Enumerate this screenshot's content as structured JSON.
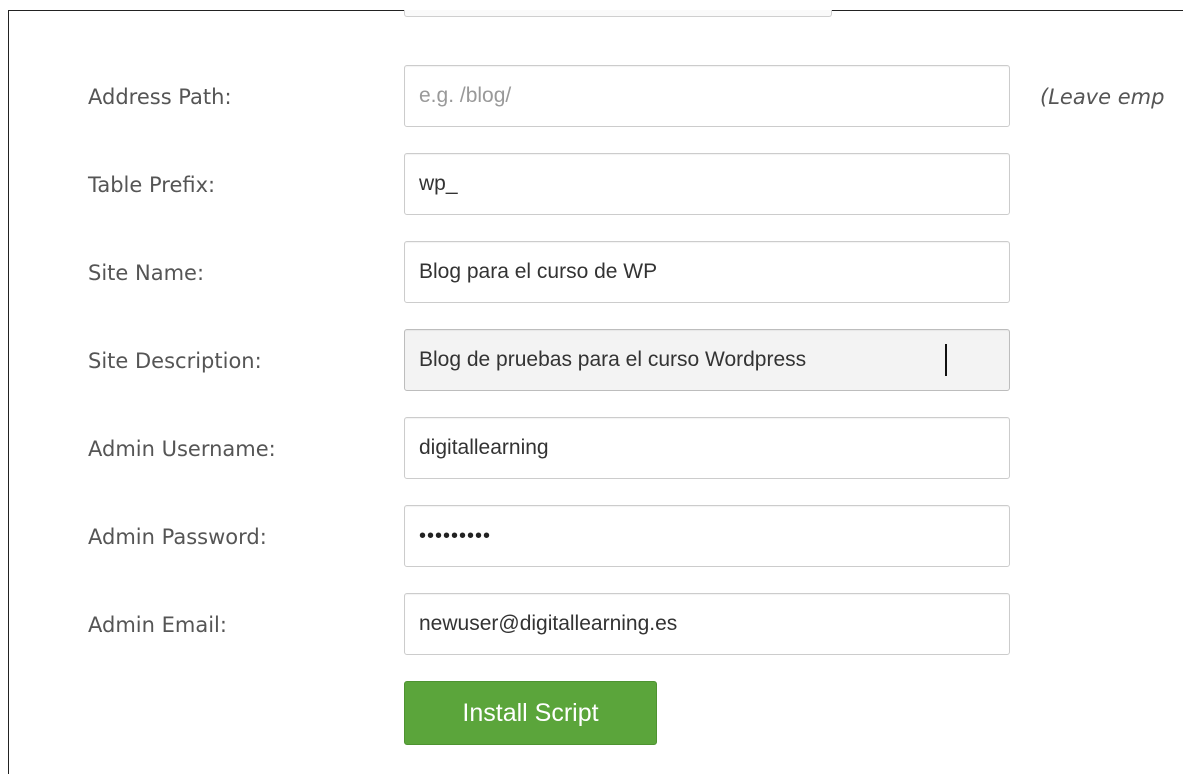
{
  "form": {
    "address_path": {
      "label": "Address Path:",
      "placeholder": "e.g. /blog/",
      "value": "",
      "hint": "(Leave emp"
    },
    "table_prefix": {
      "label": "Table Prefix:",
      "value": "wp_"
    },
    "site_name": {
      "label": "Site Name:",
      "value": "Blog para el curso de WP"
    },
    "site_description": {
      "label": "Site Description:",
      "value": "Blog de pruebas para el curso Wordpress"
    },
    "admin_username": {
      "label": "Admin Username:",
      "value": "digitallearning"
    },
    "admin_password": {
      "label": "Admin Password:",
      "value": "•••••••••"
    },
    "admin_email": {
      "label": "Admin Email:",
      "value": "newuser@digitallearning.es"
    },
    "install_button": "Install Script"
  },
  "colors": {
    "button_green": "#5ba53b",
    "label_gray": "#555555",
    "field_border": "#cccccc"
  }
}
